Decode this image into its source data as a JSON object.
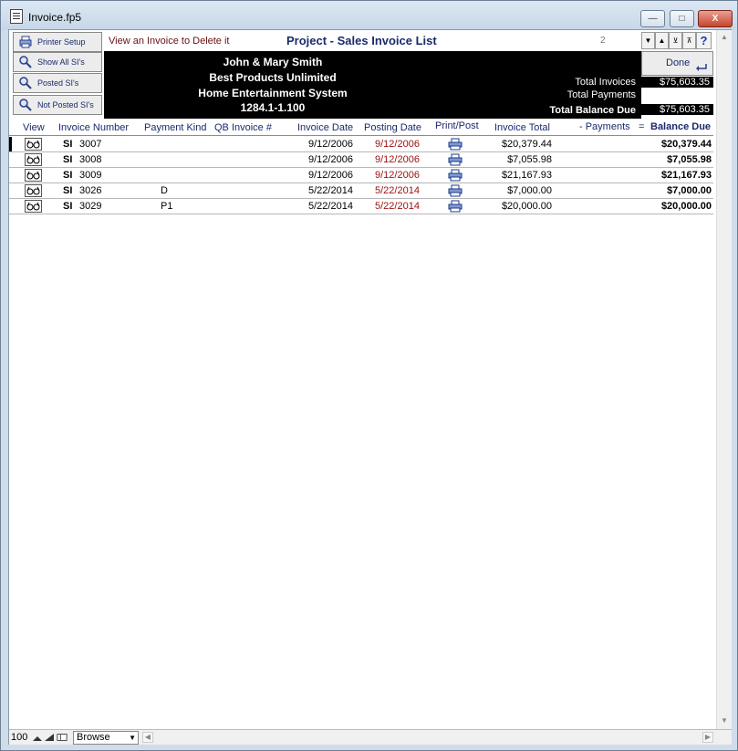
{
  "window": {
    "title": "Invoice.fp5",
    "minimize_label": "—",
    "maximize_label": "□",
    "close_label": "X"
  },
  "toolbar": {
    "printer_setup": "Printer Setup",
    "show_all": "Show All SI's",
    "posted": "Posted SI's",
    "not_posted": "Not Posted SI's",
    "delete_note": "View an Invoice to Delete it",
    "list_title": "Project - Sales Invoice List",
    "page_number": "2",
    "done": "Done",
    "help": "?"
  },
  "customer": {
    "name": "John & Mary Smith",
    "company": "Best Products Unlimited",
    "project": "Home Entertainment System",
    "code": "1284.1-1.100"
  },
  "totals": {
    "invoices_label": "Total Invoices",
    "invoices_value": "$75,603.35",
    "payments_label": "Total Payments",
    "payments_value": "",
    "balance_label": "Total Balance Due",
    "balance_value": "$75,603.35"
  },
  "columns": {
    "view": "View",
    "invoice_number": "Invoice Number",
    "payment_kind": "Payment Kind",
    "qb_invoice": "QB Invoice #",
    "invoice_date": "Invoice Date",
    "posting_date": "Posting Date",
    "print_post": "Print/Post",
    "invoice_total": "Invoice Total",
    "payments": "-  Payments",
    "equals": "=",
    "balance_due": "Balance Due"
  },
  "rows": [
    {
      "type": "SI",
      "number": "3007",
      "payment_kind": "",
      "qb": "",
      "invoice_date": "9/12/2006",
      "posting_date": "9/12/2006",
      "invoice_total": "$20,379.44",
      "payments": "",
      "balance": "$20,379.44"
    },
    {
      "type": "SI",
      "number": "3008",
      "payment_kind": "",
      "qb": "",
      "invoice_date": "9/12/2006",
      "posting_date": "9/12/2006",
      "invoice_total": "$7,055.98",
      "payments": "",
      "balance": "$7,055.98"
    },
    {
      "type": "SI",
      "number": "3009",
      "payment_kind": "",
      "qb": "",
      "invoice_date": "9/12/2006",
      "posting_date": "9/12/2006",
      "invoice_total": "$21,167.93",
      "payments": "",
      "balance": "$21,167.93"
    },
    {
      "type": "SI",
      "number": "3026",
      "payment_kind": "D",
      "qb": "",
      "invoice_date": "5/22/2014",
      "posting_date": "5/22/2014",
      "invoice_total": "$7,000.00",
      "payments": "",
      "balance": "$7,000.00"
    },
    {
      "type": "SI",
      "number": "3029",
      "payment_kind": "P1",
      "qb": "",
      "invoice_date": "5/22/2014",
      "posting_date": "5/22/2014",
      "invoice_total": "$20,000.00",
      "payments": "",
      "balance": "$20,000.00"
    }
  ],
  "statusbar": {
    "zoom": "100",
    "mode": "Browse"
  }
}
